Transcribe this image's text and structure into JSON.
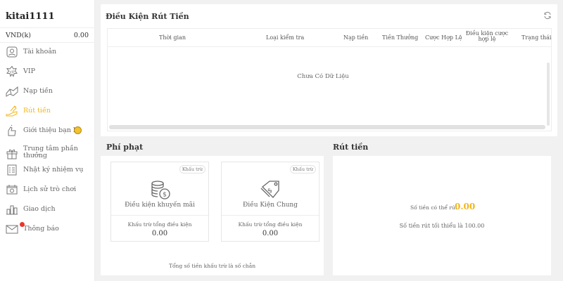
{
  "user": {
    "name": "kitai1111",
    "currency": "VND(k)",
    "balance": "0.00"
  },
  "sidebar": {
    "items": [
      {
        "label": "Tài khoản",
        "icon": "user-icon"
      },
      {
        "label": "VIP",
        "icon": "vip-icon"
      },
      {
        "label": "Nạp tiền",
        "icon": "deposit-icon"
      },
      {
        "label": "Rút tiền",
        "icon": "withdraw-icon",
        "active": true
      },
      {
        "label": "Giới thiệu bạn bè",
        "icon": "referral-icon"
      },
      {
        "label": "Trung tâm phần thưởng",
        "icon": "gift-icon"
      },
      {
        "label": "Nhật ký nhiệm vụ",
        "icon": "task-log-icon"
      },
      {
        "label": "Lịch sử trò chơi",
        "icon": "game-history-icon"
      },
      {
        "label": "Giao dịch",
        "icon": "transactions-icon"
      },
      {
        "label": "Thông báo",
        "icon": "mail-icon"
      }
    ],
    "accent": "#f2b619"
  },
  "conditions": {
    "title": "Điều Kiện Rút Tiền",
    "columns": [
      "Thời gian",
      "Loại kiểm tra",
      "Nạp tiền",
      "Tiền Thưởng",
      "Cược Hợp Lệ",
      "Điều kiện cược hợp lệ",
      "Trạng thái"
    ],
    "empty": "Chưa Có Dữ Liệu"
  },
  "penalty": {
    "title": "Phí phạt",
    "cards": [
      {
        "tag": "Khấu trừ",
        "title": "Điều kiện khuyến mãi",
        "sub": "Khấu trừ tổng điều kiện",
        "value": "0.00",
        "icon": "coins-icon"
      },
      {
        "tag": "Khấu trừ",
        "title": "Điều Kiện Chung",
        "sub": "Khấu trừ tổng điều kiện",
        "value": "0.00",
        "icon": "price-tag-icon"
      }
    ],
    "note": "Tổng số tiền khấu trừ là số chẵn"
  },
  "withdraw": {
    "title": "Rút tiền",
    "available_label": "Số tiền có thể rút",
    "available_value": "0.00",
    "min_note": "Số tiền rút tối thiểu là 100.00"
  }
}
